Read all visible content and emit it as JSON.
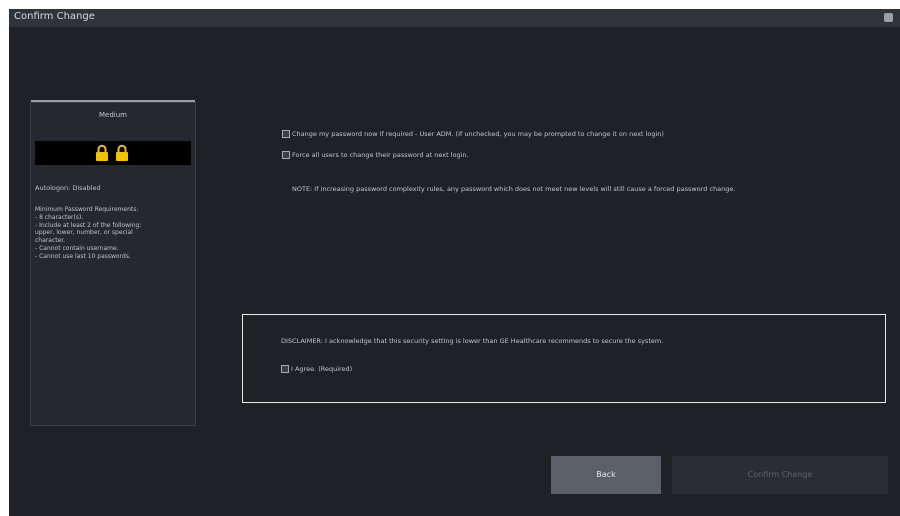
{
  "window": {
    "title": "Confirm Change"
  },
  "level_panel": {
    "level_name": "Medium",
    "autologon": "Autologon: Disabled",
    "requirements": "Minimum Password Requirements:\n - 8 character(s).\n - Include at least 2 of the following:\nupper, lower, number, or special\ncharacter.\n - Cannot contain username.\n - Cannot use last 10 passwords.",
    "icons": [
      "lock-icon",
      "lock-icon"
    ],
    "lock_color": "#f2c200"
  },
  "options": {
    "change_own_password": "Change my password now if required - User ADM. (If unchecked, you may be prompted to change it on next login)",
    "force_all_users": "Force all users to change their password at next login.",
    "note": "NOTE: If increasing password complexity rules, any password which does not meet new levels will still cause a forced password change."
  },
  "disclaimer": {
    "text": "DISCLAIMER: I acknowledge that this security setting is lower than GE Healthcare recommends to secure the system.",
    "agree_label": "I Agree. (Required)"
  },
  "buttons": {
    "back": "Back",
    "confirm": "Confirm Change"
  }
}
